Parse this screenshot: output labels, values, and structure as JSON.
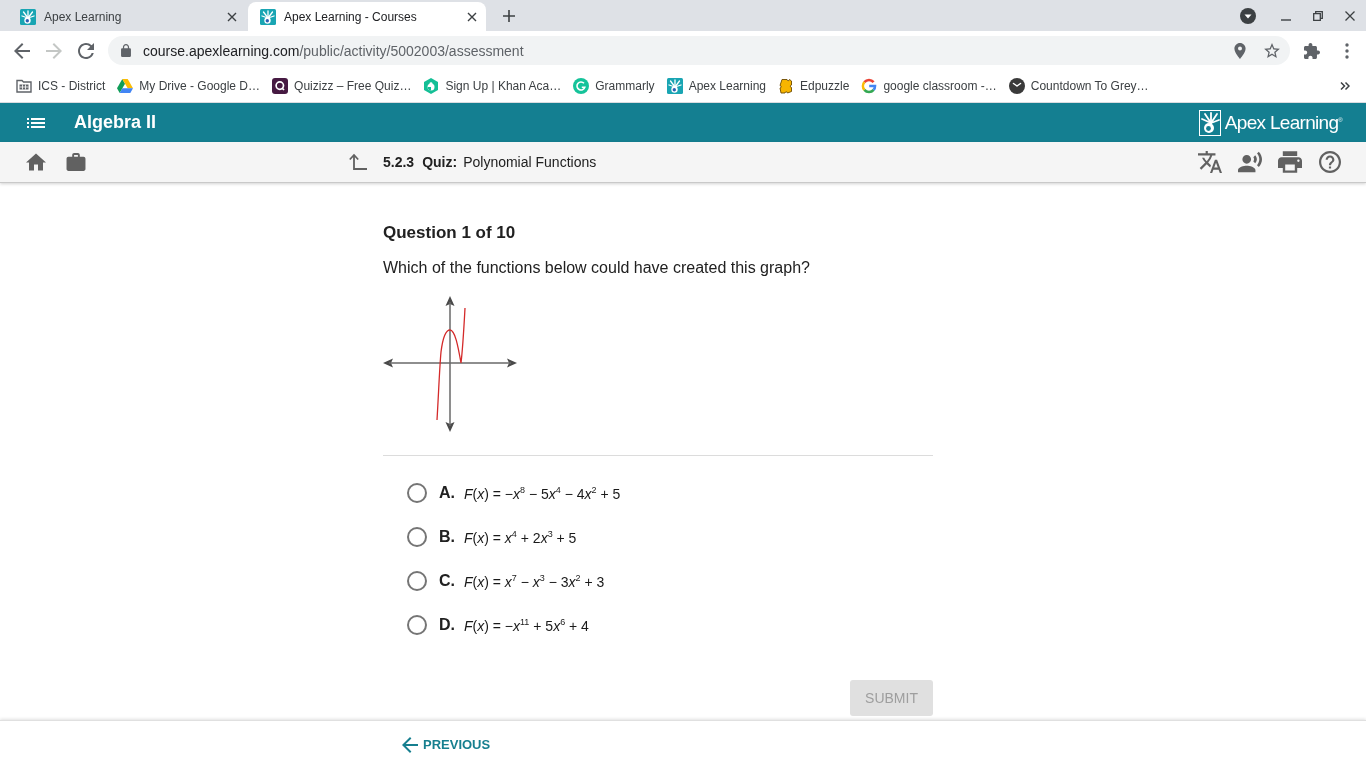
{
  "browser": {
    "tabs": [
      {
        "title": "Apex Learning",
        "selected": false
      },
      {
        "title": "Apex Learning - Courses",
        "selected": true
      }
    ],
    "nav_buttons": [
      {
        "kind": "back",
        "disabled": false
      },
      {
        "kind": "forward",
        "disabled": true
      },
      {
        "kind": "reload",
        "disabled": false
      }
    ],
    "address": {
      "host": "course.apexlearning.com",
      "path": "/public/activity/5002003/assessment"
    },
    "bookmarks": [
      {
        "kind": "folder",
        "label": "ICS - District"
      },
      {
        "kind": "triangle",
        "label": "My Drive - Google D…"
      },
      {
        "kind": "ring-tile",
        "label": "Quizizz – Free Quiz…"
      },
      {
        "kind": "hexagon",
        "label": "Sign Up | Khan Aca…"
      },
      {
        "kind": "disc",
        "label": "Grammarly"
      },
      {
        "kind": "sunburst",
        "label": "Apex Learning"
      },
      {
        "kind": "puzzle",
        "label": "Edpuzzle"
      },
      {
        "kind": "segmented-ring",
        "label": "google classroom -…"
      },
      {
        "kind": "clock",
        "label": "Countdown To Grey…"
      }
    ]
  },
  "app_bar": {
    "course_title": "Algebra II",
    "brand": "Apex Learning$^{®}$"
  },
  "activity_bar": {
    "number": "5.2.3",
    "type": "Quiz:",
    "title": "Polynomial Functions"
  },
  "question": {
    "counter": "Question 1 of 10",
    "prompt": "Which of the functions below could have created this graph?"
  },
  "choices": [
    {
      "letter": "A.",
      "formula": "F(x) = −x$^{8}$ − 5x$^{4}$ − 4x$^{2}$ + 5",
      "selected": false
    },
    {
      "letter": "B.",
      "formula": "F(x) = x$^{4}$ + 2x$^{3}$ + 5",
      "selected": false
    },
    {
      "letter": "C.",
      "formula": "F(x) = x$^{7}$ − x$^{3}$ − 3x$^{2}$ + 3",
      "selected": false
    },
    {
      "letter": "D.",
      "formula": "F(x) = −x$^{11}$ + 5x$^{6}$ + 4",
      "selected": false
    }
  ],
  "submit": {
    "label": "SUBMIT",
    "disabled": true
  },
  "footer": {
    "previous": "PREVIOUS"
  }
}
